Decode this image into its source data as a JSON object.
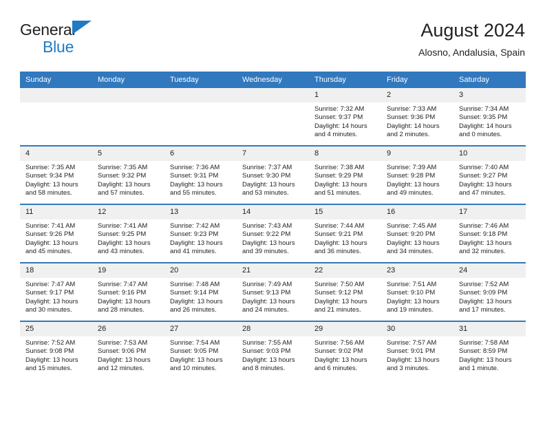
{
  "brand": {
    "name_part1": "General",
    "name_part2": "Blue",
    "triangle_icon": "triangle-icon",
    "accent_color": "#1e7bc4"
  },
  "header": {
    "title": "August 2024",
    "subtitle": "Alosno, Andalusia, Spain"
  },
  "theme": {
    "header_blue": "#3178be",
    "daynum_gray": "#f0f0f0",
    "text": "#222222"
  },
  "weekdays": [
    "Sunday",
    "Monday",
    "Tuesday",
    "Wednesday",
    "Thursday",
    "Friday",
    "Saturday"
  ],
  "weeks": [
    [
      {
        "day": "",
        "blank": true
      },
      {
        "day": "",
        "blank": true
      },
      {
        "day": "",
        "blank": true
      },
      {
        "day": "",
        "blank": true
      },
      {
        "day": "1",
        "sunrise": "Sunrise: 7:32 AM",
        "sunset": "Sunset: 9:37 PM",
        "daylight": "Daylight: 14 hours and 4 minutes."
      },
      {
        "day": "2",
        "sunrise": "Sunrise: 7:33 AM",
        "sunset": "Sunset: 9:36 PM",
        "daylight": "Daylight: 14 hours and 2 minutes."
      },
      {
        "day": "3",
        "sunrise": "Sunrise: 7:34 AM",
        "sunset": "Sunset: 9:35 PM",
        "daylight": "Daylight: 14 hours and 0 minutes."
      }
    ],
    [
      {
        "day": "4",
        "sunrise": "Sunrise: 7:35 AM",
        "sunset": "Sunset: 9:34 PM",
        "daylight": "Daylight: 13 hours and 58 minutes."
      },
      {
        "day": "5",
        "sunrise": "Sunrise: 7:35 AM",
        "sunset": "Sunset: 9:32 PM",
        "daylight": "Daylight: 13 hours and 57 minutes."
      },
      {
        "day": "6",
        "sunrise": "Sunrise: 7:36 AM",
        "sunset": "Sunset: 9:31 PM",
        "daylight": "Daylight: 13 hours and 55 minutes."
      },
      {
        "day": "7",
        "sunrise": "Sunrise: 7:37 AM",
        "sunset": "Sunset: 9:30 PM",
        "daylight": "Daylight: 13 hours and 53 minutes."
      },
      {
        "day": "8",
        "sunrise": "Sunrise: 7:38 AM",
        "sunset": "Sunset: 9:29 PM",
        "daylight": "Daylight: 13 hours and 51 minutes."
      },
      {
        "day": "9",
        "sunrise": "Sunrise: 7:39 AM",
        "sunset": "Sunset: 9:28 PM",
        "daylight": "Daylight: 13 hours and 49 minutes."
      },
      {
        "day": "10",
        "sunrise": "Sunrise: 7:40 AM",
        "sunset": "Sunset: 9:27 PM",
        "daylight": "Daylight: 13 hours and 47 minutes."
      }
    ],
    [
      {
        "day": "11",
        "sunrise": "Sunrise: 7:41 AM",
        "sunset": "Sunset: 9:26 PM",
        "daylight": "Daylight: 13 hours and 45 minutes."
      },
      {
        "day": "12",
        "sunrise": "Sunrise: 7:41 AM",
        "sunset": "Sunset: 9:25 PM",
        "daylight": "Daylight: 13 hours and 43 minutes."
      },
      {
        "day": "13",
        "sunrise": "Sunrise: 7:42 AM",
        "sunset": "Sunset: 9:23 PM",
        "daylight": "Daylight: 13 hours and 41 minutes."
      },
      {
        "day": "14",
        "sunrise": "Sunrise: 7:43 AM",
        "sunset": "Sunset: 9:22 PM",
        "daylight": "Daylight: 13 hours and 39 minutes."
      },
      {
        "day": "15",
        "sunrise": "Sunrise: 7:44 AM",
        "sunset": "Sunset: 9:21 PM",
        "daylight": "Daylight: 13 hours and 36 minutes."
      },
      {
        "day": "16",
        "sunrise": "Sunrise: 7:45 AM",
        "sunset": "Sunset: 9:20 PM",
        "daylight": "Daylight: 13 hours and 34 minutes."
      },
      {
        "day": "17",
        "sunrise": "Sunrise: 7:46 AM",
        "sunset": "Sunset: 9:18 PM",
        "daylight": "Daylight: 13 hours and 32 minutes."
      }
    ],
    [
      {
        "day": "18",
        "sunrise": "Sunrise: 7:47 AM",
        "sunset": "Sunset: 9:17 PM",
        "daylight": "Daylight: 13 hours and 30 minutes."
      },
      {
        "day": "19",
        "sunrise": "Sunrise: 7:47 AM",
        "sunset": "Sunset: 9:16 PM",
        "daylight": "Daylight: 13 hours and 28 minutes."
      },
      {
        "day": "20",
        "sunrise": "Sunrise: 7:48 AM",
        "sunset": "Sunset: 9:14 PM",
        "daylight": "Daylight: 13 hours and 26 minutes."
      },
      {
        "day": "21",
        "sunrise": "Sunrise: 7:49 AM",
        "sunset": "Sunset: 9:13 PM",
        "daylight": "Daylight: 13 hours and 24 minutes."
      },
      {
        "day": "22",
        "sunrise": "Sunrise: 7:50 AM",
        "sunset": "Sunset: 9:12 PM",
        "daylight": "Daylight: 13 hours and 21 minutes."
      },
      {
        "day": "23",
        "sunrise": "Sunrise: 7:51 AM",
        "sunset": "Sunset: 9:10 PM",
        "daylight": "Daylight: 13 hours and 19 minutes."
      },
      {
        "day": "24",
        "sunrise": "Sunrise: 7:52 AM",
        "sunset": "Sunset: 9:09 PM",
        "daylight": "Daylight: 13 hours and 17 minutes."
      }
    ],
    [
      {
        "day": "25",
        "sunrise": "Sunrise: 7:52 AM",
        "sunset": "Sunset: 9:08 PM",
        "daylight": "Daylight: 13 hours and 15 minutes."
      },
      {
        "day": "26",
        "sunrise": "Sunrise: 7:53 AM",
        "sunset": "Sunset: 9:06 PM",
        "daylight": "Daylight: 13 hours and 12 minutes."
      },
      {
        "day": "27",
        "sunrise": "Sunrise: 7:54 AM",
        "sunset": "Sunset: 9:05 PM",
        "daylight": "Daylight: 13 hours and 10 minutes."
      },
      {
        "day": "28",
        "sunrise": "Sunrise: 7:55 AM",
        "sunset": "Sunset: 9:03 PM",
        "daylight": "Daylight: 13 hours and 8 minutes."
      },
      {
        "day": "29",
        "sunrise": "Sunrise: 7:56 AM",
        "sunset": "Sunset: 9:02 PM",
        "daylight": "Daylight: 13 hours and 6 minutes."
      },
      {
        "day": "30",
        "sunrise": "Sunrise: 7:57 AM",
        "sunset": "Sunset: 9:01 PM",
        "daylight": "Daylight: 13 hours and 3 minutes."
      },
      {
        "day": "31",
        "sunrise": "Sunrise: 7:58 AM",
        "sunset": "Sunset: 8:59 PM",
        "daylight": "Daylight: 13 hours and 1 minute."
      }
    ]
  ]
}
